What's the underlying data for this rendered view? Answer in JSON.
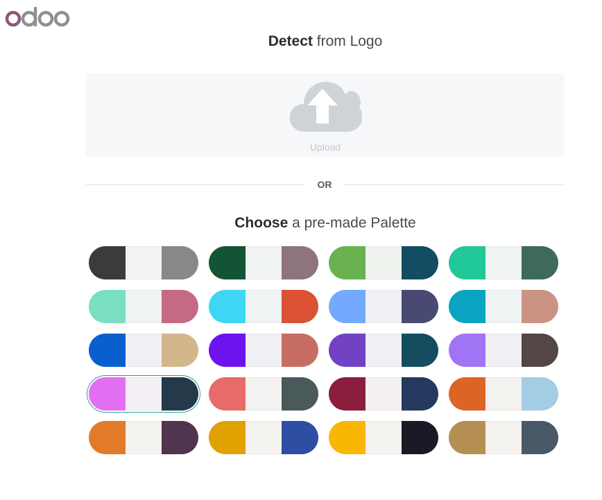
{
  "brand": {
    "name": "odoo",
    "colors": {
      "o1": "#875a7b",
      "rest": "#8f8f8f"
    }
  },
  "detect": {
    "title_strong": "Detect",
    "title_rest": " from Logo"
  },
  "upload": {
    "label": "Upload",
    "icon": "cloud-upload-icon"
  },
  "separator": {
    "label": "OR"
  },
  "choose": {
    "title_strong": "Choose",
    "title_rest": " a pre-made Palette"
  },
  "palettes": [
    [
      "#3b3b3d",
      "#f2f2f2",
      "#888888"
    ],
    [
      "#125434",
      "#eff3f1",
      "#8e747c"
    ],
    [
      "#6ab150",
      "#eef3ee",
      "#124d62"
    ],
    [
      "#20c997",
      "#eff3f2",
      "#3f6a59"
    ],
    [
      "#7adfc2",
      "#eff3f2",
      "#c46b83"
    ],
    [
      "#3fd6f4",
      "#eff3f4",
      "#db5133"
    ],
    [
      "#73a9ff",
      "#eff1f6",
      "#494a73"
    ],
    [
      "#0ba3c2",
      "#eff3f4",
      "#cb9384"
    ],
    [
      "#085fcd",
      "#eff0f5",
      "#d3b68c"
    ],
    [
      "#6d13ef",
      "#f0eff4",
      "#c66e64"
    ],
    [
      "#7143c4",
      "#f0eff4",
      "#134d5f"
    ],
    [
      "#a173f5",
      "#f0eff4",
      "#524745"
    ],
    [
      "#e26ff3",
      "#f4eff4",
      "#243a4b"
    ],
    [
      "#e76b69",
      "#f4f2f1",
      "#4a5a5b"
    ],
    [
      "#8b1d3d",
      "#f4eff1",
      "#25385e"
    ],
    [
      "#de6326",
      "#f4f2ef",
      "#a2cde4"
    ],
    [
      "#e17b29",
      "#f4f2ef",
      "#51344f"
    ],
    [
      "#e0a200",
      "#f4f3ef",
      "#2d4ea3"
    ],
    [
      "#f9b603",
      "#f4f3ef",
      "#1c1826"
    ],
    [
      "#b68f53",
      "#f4f2ef",
      "#4a5968"
    ]
  ],
  "selected_palette": 12
}
